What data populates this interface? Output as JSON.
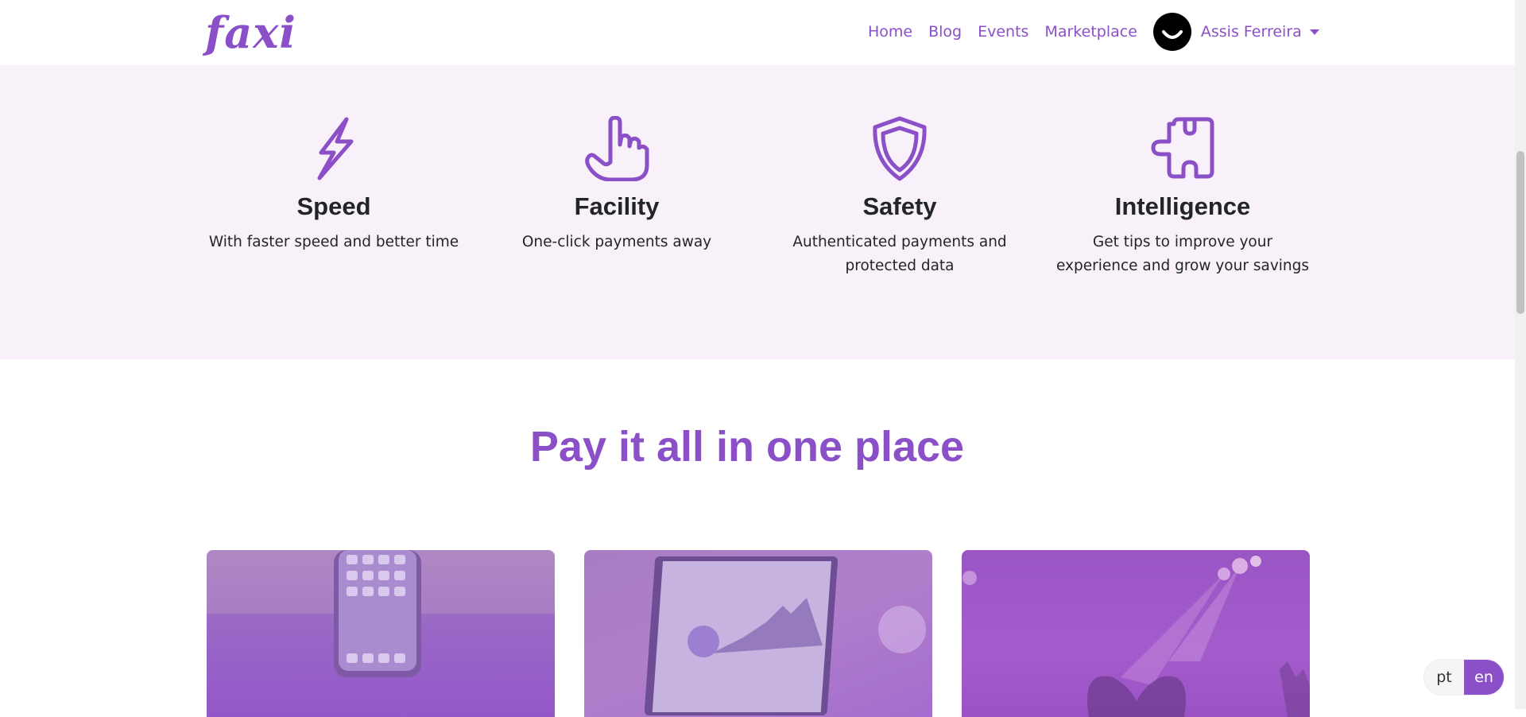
{
  "brand": {
    "logo": "faxi",
    "accent_color": "#8b4fc8"
  },
  "nav": {
    "links": [
      "Home",
      "Blog",
      "Events",
      "Marketplace"
    ],
    "user_name": "Assis Ferreira"
  },
  "features": [
    {
      "icon": "lightning-icon",
      "title": "Speed",
      "desc_lines": [
        "With faster speed and better time"
      ]
    },
    {
      "icon": "pointing-hand-icon",
      "title": "Facility",
      "desc_lines": [
        "One-click payments away"
      ]
    },
    {
      "icon": "shield-icon",
      "title": "Safety",
      "desc_lines": [
        "Authenticated payments and",
        "protected data"
      ]
    },
    {
      "icon": "puzzle-icon",
      "title": "Intelligence",
      "desc_lines": [
        "Get tips to improve your",
        "experience and grow your savings"
      ]
    }
  ],
  "section": {
    "title": "Pay it all in one place"
  },
  "cards": [
    {
      "image": "phone-image"
    },
    {
      "image": "laptop-chart-image"
    },
    {
      "image": "concert-image"
    }
  ],
  "language": {
    "options": [
      "pt",
      "en"
    ],
    "selected": "en"
  }
}
